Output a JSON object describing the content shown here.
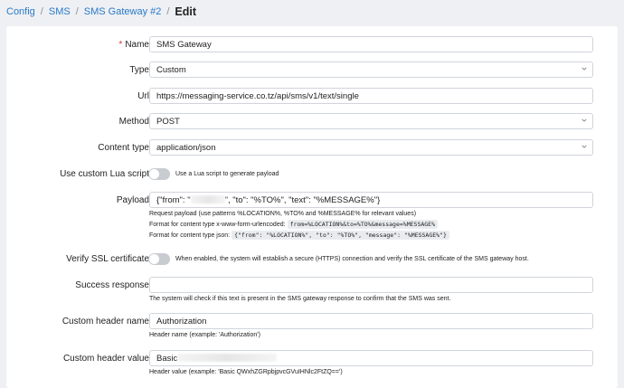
{
  "breadcrumb": {
    "items": [
      "Config",
      "SMS",
      "SMS Gateway #2"
    ],
    "current": "Edit"
  },
  "form": {
    "name": {
      "label": "Name",
      "required_mark": "*",
      "value": "SMS Gateway"
    },
    "type": {
      "label": "Type",
      "value": "Custom"
    },
    "url": {
      "label": "Url",
      "value": "https://messaging-service.co.tz/api/sms/v1/text/single"
    },
    "method": {
      "label": "Method",
      "value": "POST"
    },
    "content_type": {
      "label": "Content type",
      "value": "application/json"
    },
    "lua": {
      "label": "Use custom Lua script",
      "description": "Use a Lua script to generate payload",
      "enabled": false
    },
    "payload": {
      "label": "Payload",
      "value_prefix": "{\"from\": \"",
      "value_suffix": "\", \"to\": \"%TO%\", \"text\": \"%MESSAGE%\"}",
      "help1": "Request payload (use patterns %LOCATION%, %TO% and %MESSAGE% for relevant values)",
      "help2_label": "Format for content type x-www-form-urlencoded:",
      "help2_code": "from=%LOCATION%&to=%TO%&message=%MESSAGE%",
      "help3_label": "Format for content type json:",
      "help3_code": "{\"from\": \"%LOCATION%\", \"to\": \"%TO%\", \"message\": \"%MESSAGE%\"}"
    },
    "ssl": {
      "label": "Verify SSL certificate",
      "description": "When enabled, the system will establish a secure (HTTPS) connection and verify the SSL certificate of the SMS gateway host.",
      "enabled": false
    },
    "success": {
      "label": "Success response",
      "value": "",
      "help": "The system will check if this text is present in the SMS gateway response to confirm that the SMS was sent."
    },
    "header_name": {
      "label": "Custom header name",
      "value": "Authorization",
      "help": "Header name (example: 'Authorization')"
    },
    "header_value": {
      "label": "Custom header value",
      "value_prefix": "Basic",
      "help": "Header value (example: 'Basic QWxhZGRpbjpvcGVuIHNlc2FtZQ==')"
    }
  },
  "colors": {
    "link": "#2a79c9",
    "page_bg": "#eef0f3",
    "toggle_off": "#c8ccd1"
  }
}
